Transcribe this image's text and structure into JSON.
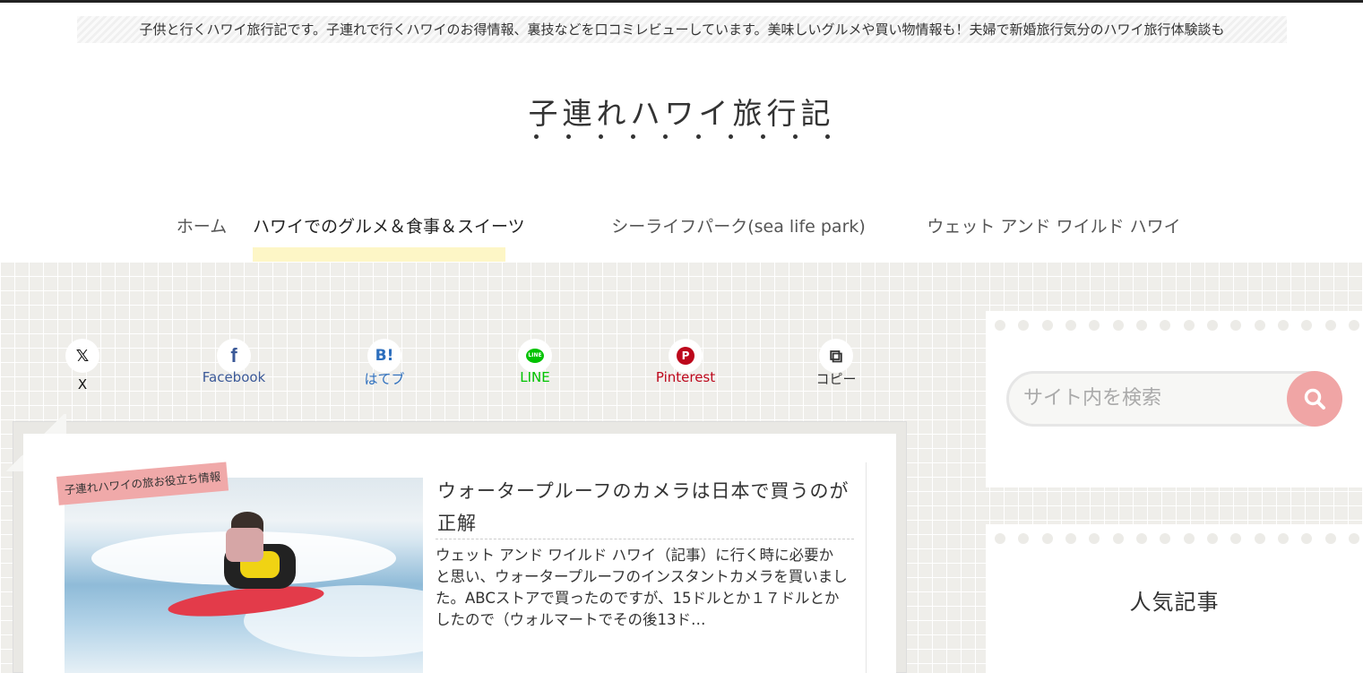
{
  "header": {
    "tagline": "子供と行くハワイ旅行記です。子連れで行くハワイのお得情報、裏技などを口コミレビューしています。美味しいグルメや買い物情報も！夫婦で新婚旅行気分のハワイ旅行体験談も",
    "site_title": "子連れハワイ旅行記"
  },
  "nav": {
    "items": [
      {
        "label": "ホーム"
      },
      {
        "label": "ハワイでのグルメ＆食事＆スイーツ"
      },
      {
        "label": "シーライフパーク(sea life park)"
      },
      {
        "label": "ウェット アンド ワイルド ハワイ"
      }
    ],
    "active_index": 1
  },
  "share": {
    "buttons": [
      {
        "icon": "x-icon",
        "glyph": "𝕏",
        "label": "X",
        "color": "#111111"
      },
      {
        "icon": "facebook-icon",
        "glyph": "f",
        "label": "Facebook",
        "color": "#3b5998"
      },
      {
        "icon": "hatena-bookmark-icon",
        "glyph": "B!",
        "label": "はてブ",
        "color": "#2c6ebd"
      },
      {
        "icon": "line-icon",
        "glyph": "LINE",
        "label": "LINE",
        "color": "#00c300"
      },
      {
        "icon": "pinterest-icon",
        "glyph": "P",
        "label": "Pinterest",
        "color": "#bd081c"
      },
      {
        "icon": "copy-icon",
        "glyph": "⧉",
        "label": "コピー",
        "color": "#333333"
      }
    ]
  },
  "post": {
    "category": "子連れハワイの旅お役立ち情報",
    "title": "ウォータープルーフのカメラは日本で買うのが正解",
    "excerpt": "ウェット アンド ワイルド ハワイ（記事）に行く時に必要かと思い、ウォータープルーフのインスタントカメラを買いました。ABCストアで買ったのですが、15ドルとか１７ドルとかしたので（ウォルマートでその後13ド…"
  },
  "sidebar": {
    "search_placeholder": "サイト内を検索",
    "popular_title": "人気記事"
  },
  "colors": {
    "accent_pink": "#f0a5a5",
    "nav_highlight": "#fdf6c6",
    "background_grid": "#efeeea"
  }
}
